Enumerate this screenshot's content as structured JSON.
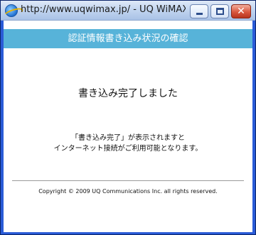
{
  "window": {
    "title": "http://www.uqwimax.jp/ - UQ WiMAX..."
  },
  "buttons": {
    "close_glyph": "✕"
  },
  "header": {
    "title": "認証情報書き込み状況の確認"
  },
  "main": {
    "heading": "書き込み完了しました",
    "note_line1": "「書き込み完了」が表示されますと",
    "note_line2": "インターネット接続がご利用可能となります。"
  },
  "footer": {
    "copyright": "Copyright © 2009 UQ Communications Inc. all rights reserved."
  },
  "colors": {
    "header_band": "#57b3d9",
    "close_button": "#d9573e"
  }
}
